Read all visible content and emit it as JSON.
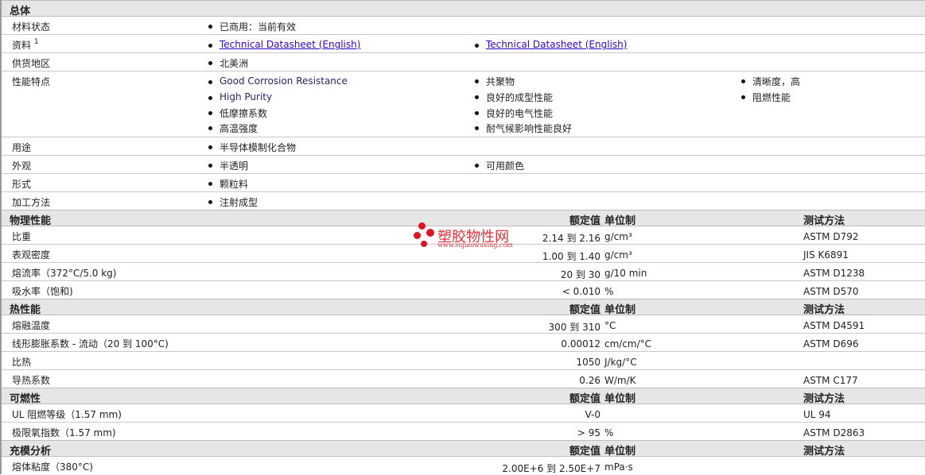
{
  "general": {
    "title": "总体",
    "rows": [
      {
        "label": "材料状态",
        "values": [
          "已商用：当前有效"
        ]
      },
      {
        "label": "资料",
        "sup": "1",
        "links": [
          "Technical Datasheet (English)",
          "Technical Datasheet (English)"
        ]
      },
      {
        "label": "供货地区",
        "values": [
          "北美洲"
        ]
      },
      {
        "label": "性能特点",
        "col1": [
          "Good Corrosion Resistance",
          "High Purity",
          "低摩擦系数",
          "高温强度"
        ],
        "col2": [
          "共聚物",
          "良好的成型性能",
          "良好的电气性能",
          "耐气候影响性能良好"
        ],
        "col3": [
          "清晰度，高",
          "阻燃性能"
        ]
      },
      {
        "label": "用途",
        "values": [
          "半导体模制化合物"
        ]
      },
      {
        "label": "外观",
        "values": [
          "半透明",
          "可用颜色"
        ]
      },
      {
        "label": "形式",
        "values": [
          "颗粒料"
        ]
      },
      {
        "label": "加工方法",
        "values": [
          "注射成型"
        ]
      }
    ]
  },
  "headers": {
    "nominal": "额定值",
    "unit": "单位制",
    "test": "测试方法"
  },
  "sections": [
    {
      "title": "物理性能",
      "rows": [
        {
          "label": "比重",
          "value": "2.14 到  2.16",
          "unit": "g/cm³",
          "test": "ASTM D792"
        },
        {
          "label": "表观密度",
          "value": "1.00 到  1.40",
          "unit": "g/cm³",
          "test": "JIS K6891"
        },
        {
          "label": "熔流率（372°C/5.0 kg)",
          "value": "20 到  30",
          "unit": "g/10 min",
          "test": "ASTM D1238"
        },
        {
          "label": "吸水率（饱和)",
          "value": "< 0.010",
          "unit": "%",
          "test": "ASTM D570"
        }
      ]
    },
    {
      "title": "热性能",
      "rows": [
        {
          "label": "熔融温度",
          "value": "300 到  310",
          "unit": "°C",
          "test": "ASTM D4591"
        },
        {
          "label": "线形膨胀系数  - 流动（20 到  100°C)",
          "value": "0.00012",
          "unit": "cm/cm/°C",
          "test": "ASTM D696"
        },
        {
          "label": "比热",
          "value": "1050",
          "unit": "J/kg/°C",
          "test": ""
        },
        {
          "label": "导热系数",
          "value": "0.26",
          "unit": "W/m/K",
          "test": "ASTM C177"
        }
      ]
    },
    {
      "title": "可燃性",
      "rows": [
        {
          "label": "UL 阻燃等级（1.57 mm)",
          "value": "V-0",
          "unit": "",
          "test": "UL 94"
        },
        {
          "label": "极限氧指数（1.57 mm)",
          "value": "> 95",
          "unit": "%",
          "test": "ASTM D2863"
        }
      ]
    },
    {
      "title": "充模分析",
      "rows": [
        {
          "label": "熔体粘度（380°C)",
          "value": "2.00E+6 到  2.50E+7",
          "unit": "mPa·s",
          "test": ""
        }
      ]
    }
  ],
  "watermark": {
    "name": "塑胶物性网",
    "url": "www.sujiaowuxing.com"
  }
}
